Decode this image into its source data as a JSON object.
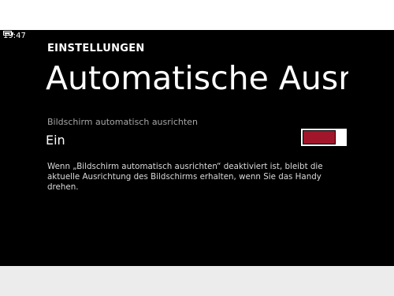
{
  "status_bar": {
    "time": "19:47",
    "battery_icon": "battery-icon"
  },
  "header": {
    "section": "EINSTELLUNGEN",
    "title": "Automatische Ausrichtung"
  },
  "setting": {
    "label": "Bildschirm automatisch ausrichten",
    "value": "Ein",
    "toggle_state": "on",
    "accent_color": "#a2162b"
  },
  "description": "Wenn „Bildschirm automatisch ausrichten“ deaktiviert ist, bleibt die aktuelle Ausrichtung des Bildschirms erhalten, wenn Sie das Handy drehen."
}
